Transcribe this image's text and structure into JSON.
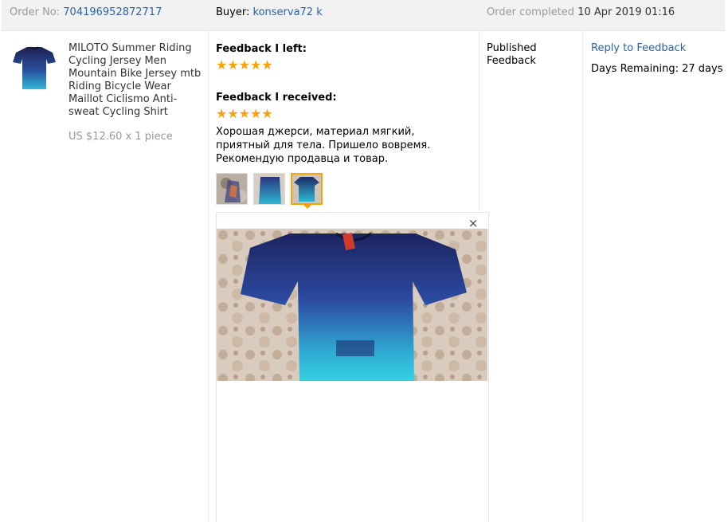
{
  "order": {
    "number_label": "Order No:",
    "number": "704196952872717",
    "buyer_label": "Buyer:",
    "buyer": "konserva72 k",
    "status_label": "Order completed",
    "completed_at": "10 Apr 2019 01:16"
  },
  "product": {
    "image_icon": "cycling-jersey-photo",
    "title": "MILOTO Summer Riding Cycling Jersey Men Mountain Bike Jersey mtb Riding Bicycle Wear Maillot Ciclismo Anti-sweat Cycling Shirt",
    "price": "US $12.60 x 1 piece"
  },
  "feedback": {
    "left_heading": "Feedback I left:",
    "left_rating": 5,
    "received_heading": "Feedback I received:",
    "received_rating": 5,
    "star_glyphs": "★★★★★",
    "text": "Хорошая джерси, материал мягкий, приятный для тела. Пришело вовремя. Рекомендую продавца и товар.",
    "thumbnails": [
      {
        "name": "photo-1"
      },
      {
        "name": "photo-2"
      },
      {
        "name": "photo-3",
        "active": true
      }
    ],
    "close_glyph": "×"
  },
  "status": {
    "label": "Published Feedback"
  },
  "actions": {
    "reply_label": "Reply to Feedback",
    "days_remaining": "Days Remaining: 27 days"
  },
  "colors": {
    "link": "#2a64a6",
    "star": "#f7a30a",
    "header_bg": "#f2f2f2",
    "muted": "#999999"
  }
}
